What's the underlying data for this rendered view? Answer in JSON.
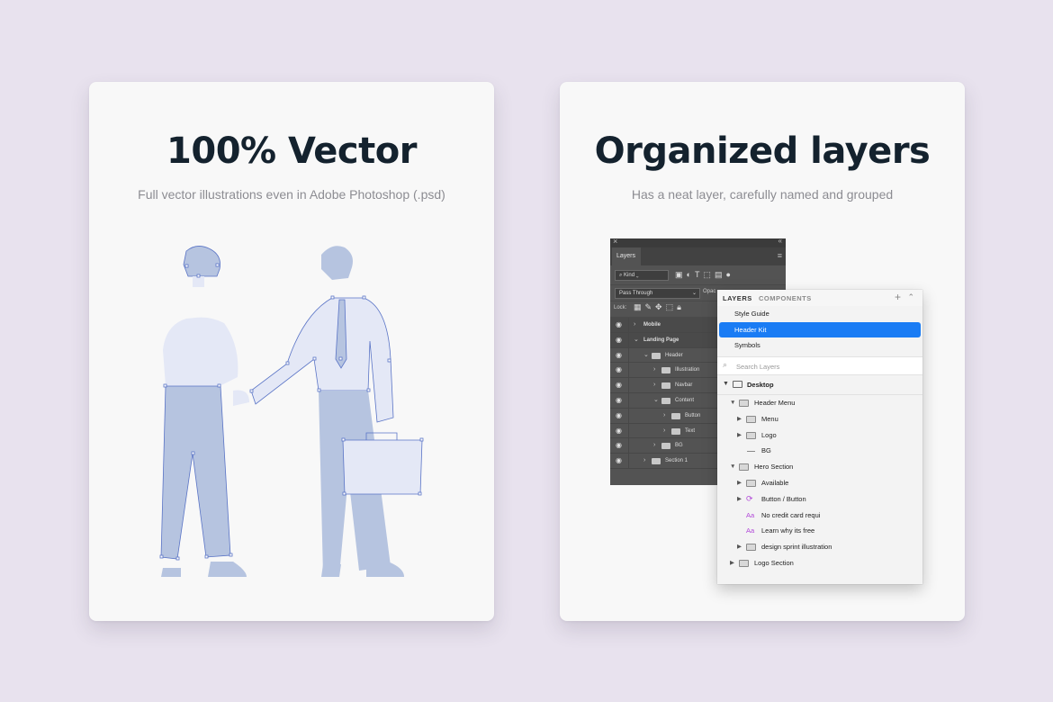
{
  "left_card": {
    "title": "100% Vector",
    "subtitle": "Full vector illustrations even in Adobe Photoshop (.psd)",
    "illustration": "two-businessmen-handshake-illustration"
  },
  "right_card": {
    "title": "Organized layers",
    "subtitle": "Has a neat layer, carefully named and grouped"
  },
  "photoshop_panel": {
    "tab": "Layers",
    "kind_filter": "Kind",
    "blend_mode": "Pass Through",
    "opacity_label": "Opac",
    "lock_label": "Lock:",
    "layers": [
      {
        "name": "Mobile",
        "depth": 0,
        "bold": true
      },
      {
        "name": "Landing Page",
        "depth": 0,
        "bold": true,
        "expanded": true
      },
      {
        "name": "Header",
        "depth": 1,
        "expanded": true
      },
      {
        "name": "Illustration",
        "depth": 2
      },
      {
        "name": "Navbar",
        "depth": 2
      },
      {
        "name": "Content",
        "depth": 2,
        "expanded": true
      },
      {
        "name": "Button",
        "depth": 3
      },
      {
        "name": "Text",
        "depth": 3
      },
      {
        "name": "BG",
        "depth": 2
      },
      {
        "name": "Section 1",
        "depth": 1
      }
    ]
  },
  "sketch_panel": {
    "tab_layers": "LAYERS",
    "tab_components": "COMPONENTS",
    "pages": [
      "Style Guide",
      "Header Kit",
      "Symbols"
    ],
    "selected_page": "Header Kit",
    "search_placeholder": "Search Layers",
    "artboard": "Desktop",
    "layers": [
      {
        "name": "Header Menu",
        "type": "group",
        "depth": 0,
        "expanded": true
      },
      {
        "name": "Menu",
        "type": "group",
        "depth": 1
      },
      {
        "name": "Logo",
        "type": "group",
        "depth": 1
      },
      {
        "name": "BG",
        "type": "shape",
        "depth": 1
      },
      {
        "name": "Hero Section",
        "type": "group",
        "depth": 0,
        "expanded": true
      },
      {
        "name": "Available",
        "type": "group",
        "depth": 1
      },
      {
        "name": "Button / Button",
        "type": "symbol",
        "depth": 1
      },
      {
        "name": "No credit card requi",
        "type": "text",
        "depth": 1
      },
      {
        "name": "Learn why its free",
        "type": "text",
        "depth": 1
      },
      {
        "name": "design sprint illustration",
        "type": "group",
        "depth": 1
      },
      {
        "name": "Logo Section",
        "type": "group",
        "depth": 0
      }
    ],
    "selection_color": "#1a7cf4",
    "text_layer_color": "#b147d8"
  },
  "colors": {
    "background": "#e8e2ee",
    "card": "#f8f8f8",
    "title": "#14222e",
    "illustration_light": "#e4e8f6",
    "illustration_mid": "#b6c4e0",
    "illustration_stroke": "#5a74c6"
  }
}
